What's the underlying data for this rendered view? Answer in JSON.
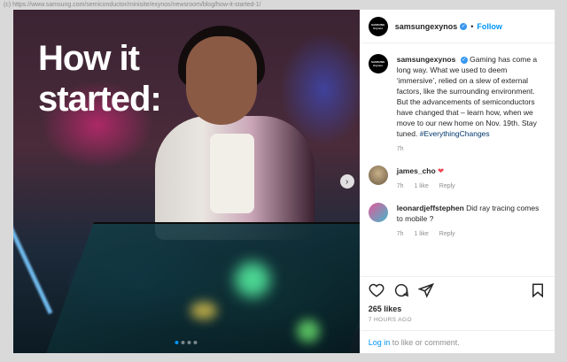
{
  "watermark": "(c) https://www.samsung.com/semiconductor/minisite/exynos/newsroom/blog/how-it-started-1/",
  "post": {
    "image_title_line1": "How it",
    "image_title_line2": "started:",
    "carousel_dots": 4,
    "active_dot": 0
  },
  "header": {
    "avatar_text_line1": "SAMSUNG",
    "avatar_text_line2": "Exynos",
    "username": "samsungexynos",
    "separator": "•",
    "follow_label": "Follow"
  },
  "caption": {
    "username": "samsungexynos",
    "text": "Gaming has come a long way. What we used to deem ‘immersive’, relied on a slew of external factors, like the surrounding environment. But the advancements of semiconductors have changed that – learn how, when we move to our new home on Nov. 19th. Stay tuned.",
    "hashtag": "#EverythingChanges",
    "time": "7h"
  },
  "comments": [
    {
      "username": "james_cho",
      "text": "",
      "time": "7h",
      "likes": "1 like",
      "reply": "Reply"
    },
    {
      "username": "leonardjeffstephen",
      "text": "Did ray tracing comes to mobile ?",
      "time": "7h",
      "likes": "1 like",
      "reply": "Reply"
    }
  ],
  "engagement": {
    "likes": "265 likes",
    "posted": "7 HOURS AGO"
  },
  "footer": {
    "login_link": "Log in",
    "login_suffix": " to like or comment."
  },
  "icons": {
    "like": "heart-outline-icon",
    "comment": "comment-bubble-icon",
    "share": "paper-plane-icon",
    "save": "bookmark-icon"
  }
}
